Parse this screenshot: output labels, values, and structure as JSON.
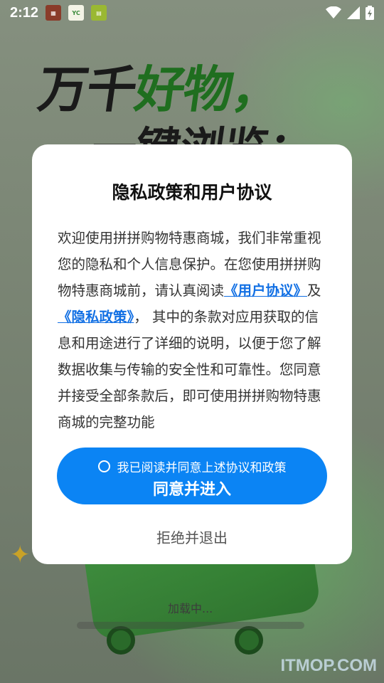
{
  "status_bar": {
    "time": "2:12",
    "app_icons": [
      "app-notification-1",
      "app-notification-2",
      "app-notification-3"
    ],
    "icons": [
      "wifi-icon",
      "signal-icon",
      "battery-charging-icon"
    ]
  },
  "background": {
    "headline_part1": "万千",
    "headline_part2": "好物，",
    "headline_line2": "一键浏览：",
    "loading_text": "加载中...",
    "watermark": "ITMOP.COM"
  },
  "dialog": {
    "title": "隐私政策和用户协议",
    "body_intro": "欢迎使用拼拼购物特惠商城，我们非常重视您的隐私和个人信息保护。在您使用拼拼购物特惠商城前，请认真阅读",
    "user_agreement_link": "《用户协议》",
    "and_text": "及",
    "privacy_policy_link": "《隐私政策》",
    "body_rest": "， 其中的条款对应用获取的信息和用途进行了详细的说明，以便于您了解数据收集与传输的安全性和可靠性。您同意并接受全部条款后，即可使用拼拼购物特惠商城的完整功能",
    "checkbox_label": "我已阅读并同意上述协议和政策",
    "agree_button": "同意并进入",
    "refuse_button": "拒绝并退出"
  },
  "colors": {
    "primary_button": "#0b84f4",
    "link": "#1270e4",
    "dialog_bg": "#ffffff"
  }
}
